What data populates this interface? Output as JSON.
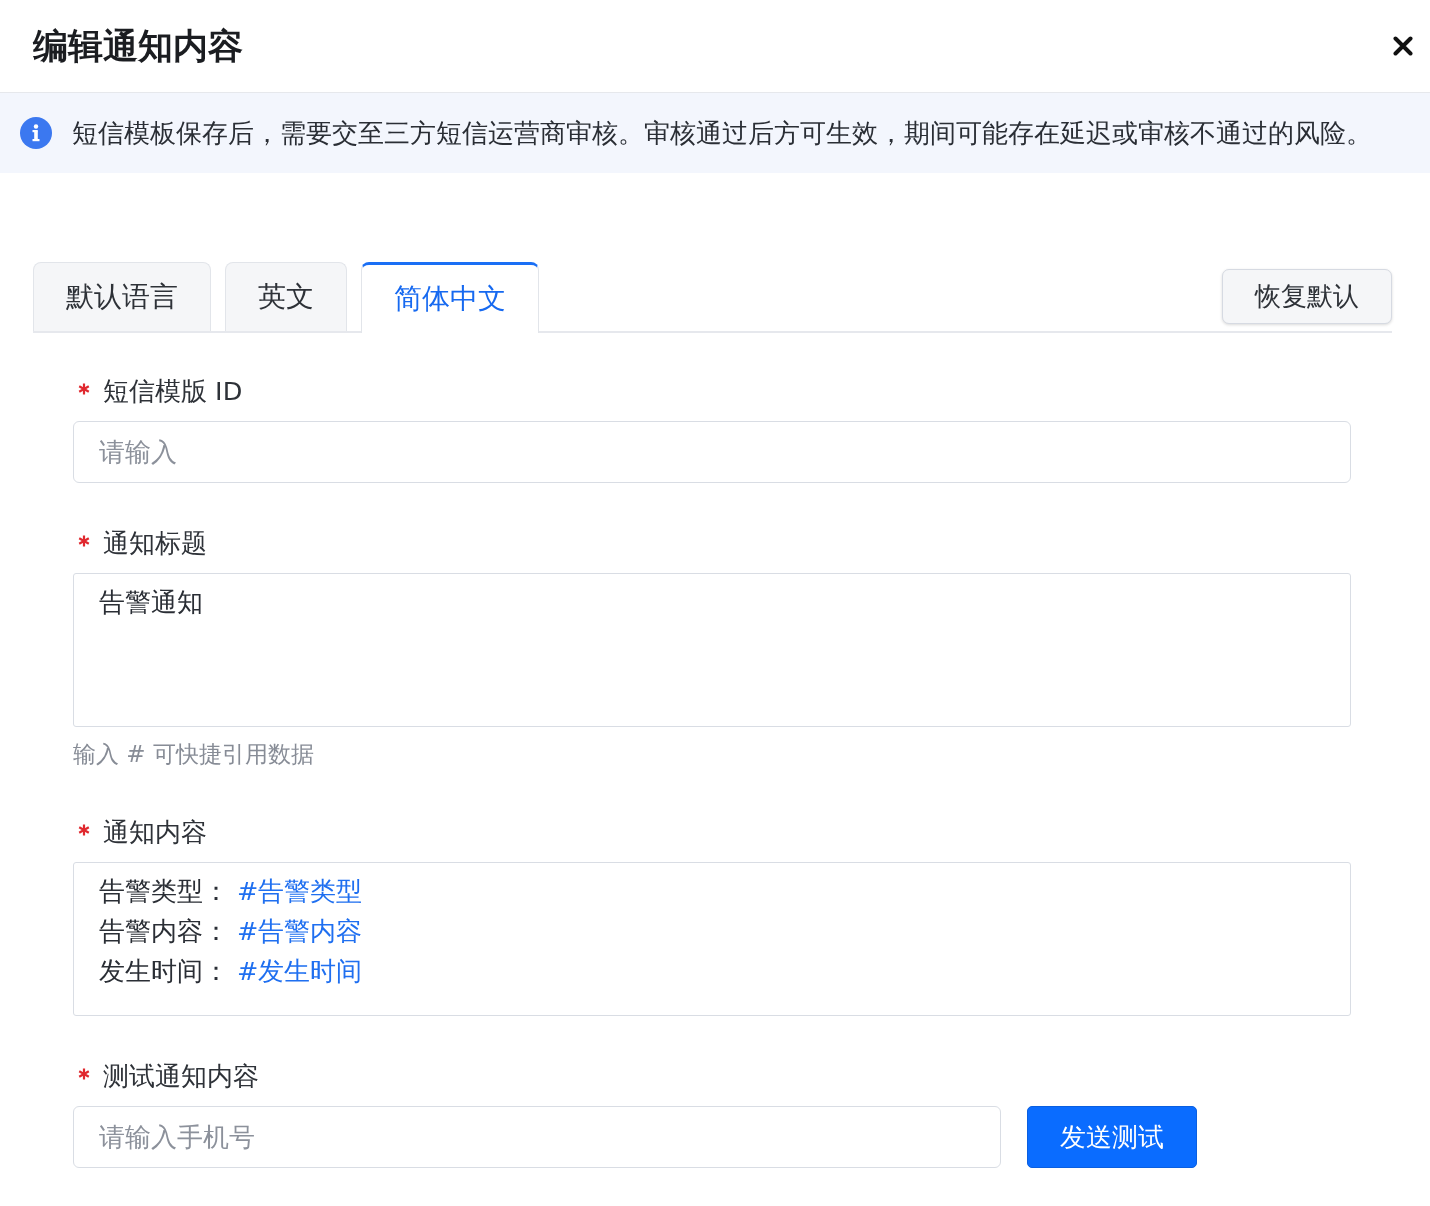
{
  "dialog": {
    "title": "编辑通知内容"
  },
  "notice": {
    "text": "短信模板保存后，需要交至三方短信运营商审核。审核通过后方可生效，期间可能存在延迟或审核不通过的风险。"
  },
  "tabs": [
    {
      "label": "默认语言",
      "selected": false
    },
    {
      "label": "英文",
      "selected": false
    },
    {
      "label": "简体中文",
      "selected": true
    }
  ],
  "reset_button": {
    "label": "恢复默认"
  },
  "form": {
    "fields": [
      {
        "kind": "input",
        "label": "短信模版 ID",
        "required": true,
        "placeholder": "请输入"
      },
      {
        "kind": "textarea",
        "label": "通知标题",
        "required": true,
        "value": "告警通知",
        "hint": "输入 # 可快捷引用数据"
      },
      {
        "kind": "template",
        "label": "通知内容",
        "required": true,
        "lines": [
          {
            "label": "告警类型：",
            "reference": "#告警类型"
          },
          {
            "label": "告警内容：",
            "reference": "#告警内容"
          },
          {
            "label": "发生时间：",
            "reference": "#发生时间"
          }
        ]
      },
      {
        "kind": "input_with_button",
        "label": "测试通知内容",
        "required": true,
        "placeholder": "请输入手机号",
        "button": "发送测试"
      }
    ]
  }
}
